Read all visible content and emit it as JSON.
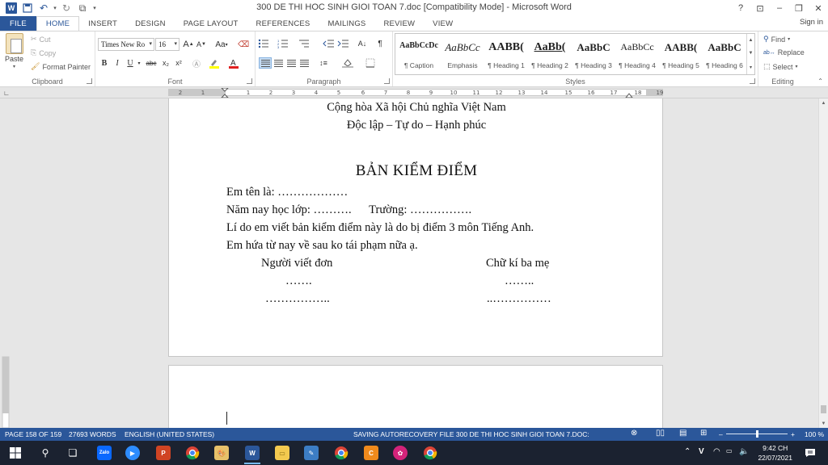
{
  "window": {
    "title": "300 DE THI HOC SINH GIOI TOAN 7.doc [Compatibility Mode] - Microsoft Word",
    "help": "?",
    "minimize": "–",
    "restore": "❐",
    "close": "✕",
    "sign_in": "Sign in"
  },
  "tabs": [
    "FILE",
    "HOME",
    "INSERT",
    "DESIGN",
    "PAGE LAYOUT",
    "REFERENCES",
    "MAILINGS",
    "REVIEW",
    "VIEW"
  ],
  "active_tab": "HOME",
  "clipboard": {
    "paste": "Paste",
    "cut": "Cut",
    "copy": "Copy",
    "format_painter": "Format Painter",
    "label": "Clipboard"
  },
  "font": {
    "name": "Times New Ro",
    "size": "16",
    "grow": "A",
    "shrink": "A",
    "case": "Aa",
    "bold": "B",
    "italic": "I",
    "underline": "U",
    "strike": "abc",
    "subscript": "x₂",
    "superscript": "x²",
    "label": "Font"
  },
  "paragraph": {
    "label": "Paragraph"
  },
  "styles": {
    "items": [
      {
        "preview": "AaBbCcDc",
        "name": "¶ Caption"
      },
      {
        "preview": "AaBbCc",
        "name": "Emphasis"
      },
      {
        "preview": "AABB(",
        "name": "¶ Heading 1"
      },
      {
        "preview": "AaBb(",
        "name": "¶ Heading 2"
      },
      {
        "preview": "AaBbC",
        "name": "¶ Heading 3"
      },
      {
        "preview": "AaBbCc",
        "name": "¶ Heading 4"
      },
      {
        "preview": "AABB(",
        "name": "¶ Heading 5"
      },
      {
        "preview": "AaBbC",
        "name": "¶ Heading 6"
      }
    ],
    "label": "Styles"
  },
  "editing": {
    "find": "Find",
    "replace": "Replace",
    "select": "Select",
    "label": "Editing"
  },
  "ruler": {
    "ticks": [
      "2",
      "1",
      "1",
      "2",
      "3",
      "4",
      "5",
      "6",
      "7",
      "8",
      "9",
      "10",
      "11",
      "12",
      "13",
      "14",
      "15",
      "16",
      "17",
      "18",
      "19"
    ]
  },
  "document": {
    "line1": "Cộng hòa Xã hội Chủ nghĩa Việt Nam",
    "line2": "Độc lập – Tự do – Hạnh phúc",
    "title": "BẢN KIỂM ĐIỂM",
    "name_line": "Em tên là: ………………",
    "class_line": "Năm nay học lớp: ……….      Trường: …………….",
    "reason_line": "Lí do em viết bản kiểm điểm này là do bị điểm 3 môn Tiếng Anh.",
    "promise_line": "Em hứa từ nay về sau ko tái phạm nữa ạ.",
    "writer_label": "Người viết đơn",
    "parent_label": "Chữ kí ba mẹ",
    "writer_dots1": "…….",
    "parent_dots1": "……..",
    "writer_dots2": "……………..",
    "parent_dots2": "..……………"
  },
  "status": {
    "page": "PAGE 158 OF 159",
    "words": "27693 WORDS",
    "language": "ENGLISH (UNITED STATES)",
    "saving": "SAVING AUTORECOVERY FILE 300 DE THI HOC SINH GIOI TOAN 7.DOC:",
    "zoom_minus": "–",
    "zoom_plus": "+",
    "zoom": "100 %"
  },
  "taskbar": {
    "time": "9:42 CH",
    "date": "22/07/2021",
    "zalo": "Zalo"
  },
  "colors": {
    "accent": "#2b579a",
    "taskbar": "#1b2230",
    "workspace": "#e6e6e6"
  }
}
